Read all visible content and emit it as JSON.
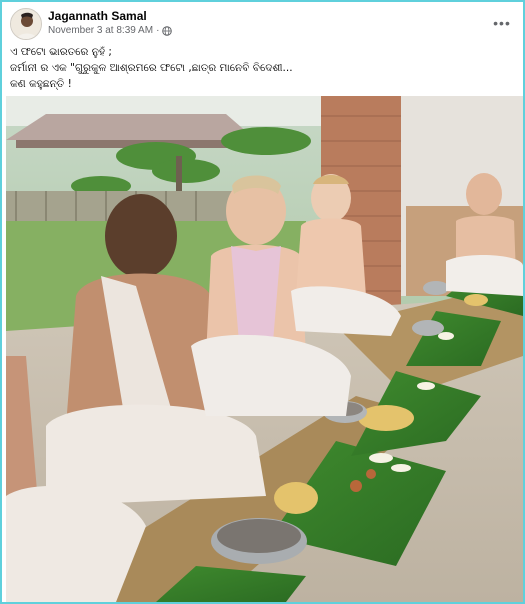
{
  "post": {
    "author": "Jagannath Samal",
    "timestamp": "November 3 at 8:39 AM",
    "separator": "·",
    "privacy_icon": "globe-icon",
    "more_icon": "more-horizontal-icon",
    "more_label": "•••",
    "caption_lines": [
      "ଏ ଫଟୋ ଭାରତରେ ନୁହଁ ;",
      "ଜର୍ମାନୀ ର ଏକ \"ଗୁରୁକୁଳ ଆଶ୍ରମରେ ଫଟୋ ,ଛାତ୍ର ମାନେବି ବିଦେଶୀ...",
      "କଣ କହୁଛନ୍ତି !"
    ]
  },
  "colors": {
    "frame_border": "#5fd0dc",
    "author_text": "#050505",
    "meta_text": "#65676b"
  }
}
